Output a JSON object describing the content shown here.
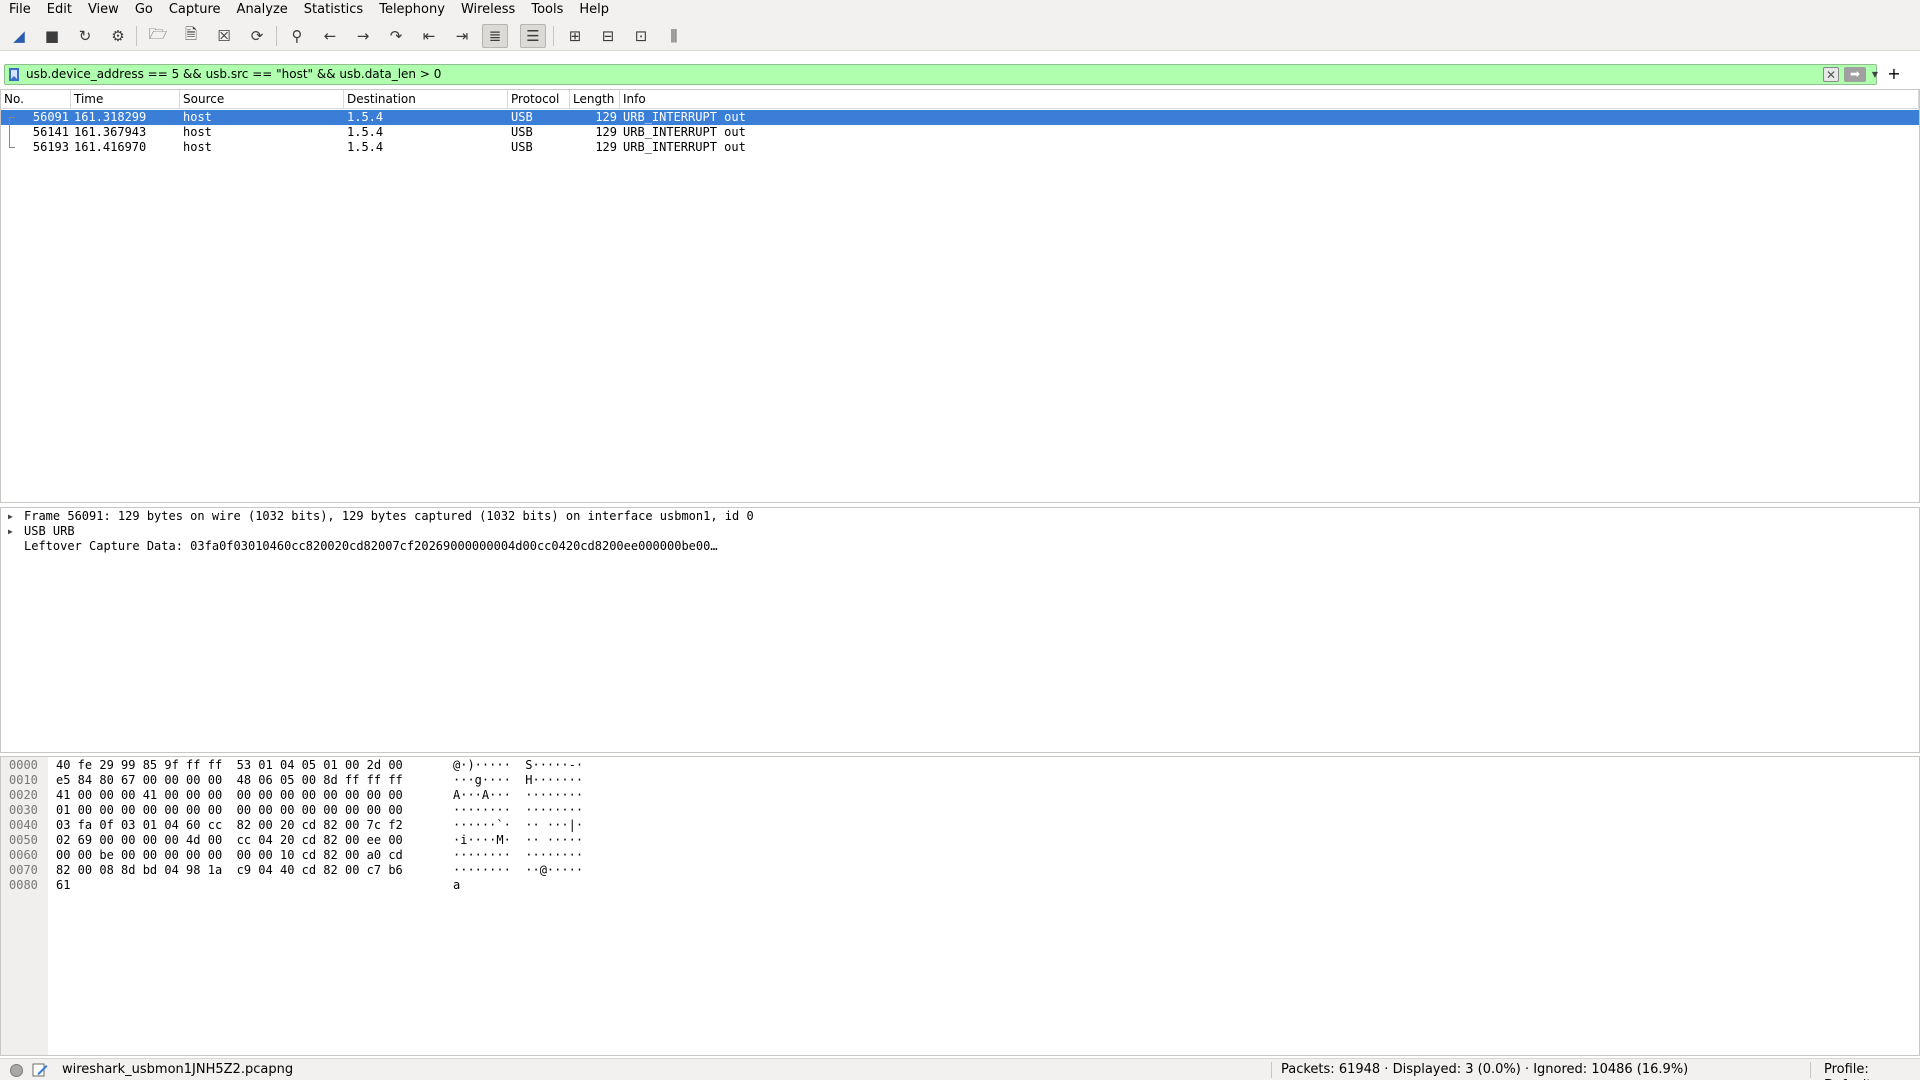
{
  "menu": [
    "File",
    "Edit",
    "View",
    "Go",
    "Capture",
    "Analyze",
    "Statistics",
    "Telephony",
    "Wireless",
    "Tools",
    "Help"
  ],
  "toolbar": {
    "buttons": [
      {
        "name": "start-capture-fin-icon",
        "glyph": "◢"
      },
      {
        "name": "stop-capture-icon",
        "glyph": "■"
      },
      {
        "name": "restart-capture-icon",
        "glyph": "↻"
      },
      {
        "name": "capture-options-gear-icon",
        "glyph": "⚙"
      },
      {
        "name": "open-file-icon",
        "glyph": "🗁"
      },
      {
        "name": "save-file-icon",
        "glyph": "🗎"
      },
      {
        "name": "close-file-icon",
        "glyph": "☒"
      },
      {
        "name": "reload-file-icon",
        "glyph": "⟳"
      },
      {
        "name": "find-packet-icon",
        "glyph": "⚲"
      },
      {
        "name": "go-back-icon",
        "glyph": "←"
      },
      {
        "name": "go-forward-icon",
        "glyph": "→"
      },
      {
        "name": "go-to-packet-icon",
        "glyph": "↷"
      },
      {
        "name": "first-packet-icon",
        "glyph": "⇤"
      },
      {
        "name": "last-packet-icon",
        "glyph": "⇥"
      },
      {
        "name": "auto-scroll-icon",
        "glyph": "≣"
      },
      {
        "name": "colorize-icon",
        "glyph": "☰"
      },
      {
        "name": "zoom-in-icon",
        "glyph": "⊞"
      },
      {
        "name": "zoom-out-icon",
        "glyph": "⊟"
      },
      {
        "name": "normal-size-icon",
        "glyph": "⊡"
      },
      {
        "name": "resize-columns-icon",
        "glyph": "⫼"
      }
    ]
  },
  "filter": {
    "text": "usb.device_address == 5 && usb.src == \"host\" && usb.data_len > 0",
    "clear_glyph": "✕",
    "apply_glyph": "➡",
    "dropdown_glyph": "▼",
    "add_glyph": "+"
  },
  "packet_list": {
    "columns": [
      "No.",
      "Time",
      "Source",
      "Destination",
      "Protocol",
      "Length",
      "Info"
    ],
    "rows": [
      {
        "no": "56091",
        "time": "161.318299",
        "source": "host",
        "destination": "1.5.4",
        "protocol": "USB",
        "length": "129",
        "info": "URB_INTERRUPT out",
        "selected": true
      },
      {
        "no": "56141",
        "time": "161.367943",
        "source": "host",
        "destination": "1.5.4",
        "protocol": "USB",
        "length": "129",
        "info": "URB_INTERRUPT out",
        "selected": false
      },
      {
        "no": "56193",
        "time": "161.416970",
        "source": "host",
        "destination": "1.5.4",
        "protocol": "USB",
        "length": "129",
        "info": "URB_INTERRUPT out",
        "selected": false
      }
    ]
  },
  "details": [
    {
      "text": "Frame 56091: 129 bytes on wire (1032 bits), 129 bytes captured (1032 bits) on interface usbmon1, id 0",
      "expandable": true
    },
    {
      "text": "USB URB",
      "expandable": true
    },
    {
      "text": "Leftover Capture Data: 03fa0f03010460cc820020cd82007cf20269000000004d00cc0420cd8200ee000000be00…",
      "expandable": false
    }
  ],
  "bytes": [
    {
      "offset": "0000",
      "hex": "40 fe 29 99 85 9f ff ff  53 01 04 05 01 00 2d 00",
      "ascii": "@·)·····  S·····-·"
    },
    {
      "offset": "0010",
      "hex": "e5 84 80 67 00 00 00 00  48 06 05 00 8d ff ff ff",
      "ascii": "···g····  H·······"
    },
    {
      "offset": "0020",
      "hex": "41 00 00 00 41 00 00 00  00 00 00 00 00 00 00 00",
      "ascii": "A···A···  ········"
    },
    {
      "offset": "0030",
      "hex": "01 00 00 00 00 00 00 00  00 00 00 00 00 00 00 00",
      "ascii": "········  ········"
    },
    {
      "offset": "0040",
      "hex": "03 fa 0f 03 01 04 60 cc  82 00 20 cd 82 00 7c f2",
      "ascii": "······`·  ·· ···|·"
    },
    {
      "offset": "0050",
      "hex": "02 69 00 00 00 00 4d 00  cc 04 20 cd 82 00 ee 00",
      "ascii": "·i····M·  ·· ·····"
    },
    {
      "offset": "0060",
      "hex": "00 00 be 00 00 00 00 00  00 00 10 cd 82 00 a0 cd",
      "ascii": "········  ········"
    },
    {
      "offset": "0070",
      "hex": "82 00 08 8d bd 04 98 1a  c9 04 40 cd 82 00 c7 b6",
      "ascii": "········  ··@·····"
    },
    {
      "offset": "0080",
      "hex": "61",
      "ascii": "a"
    }
  ],
  "status": {
    "file": "wireshark_usbmon1JNH5Z2.pcapng",
    "packets": "Packets: 61948 · Displayed: 3 (0.0%) · Ignored: 10486 (16.9%)",
    "profile": "Profile: Default"
  }
}
